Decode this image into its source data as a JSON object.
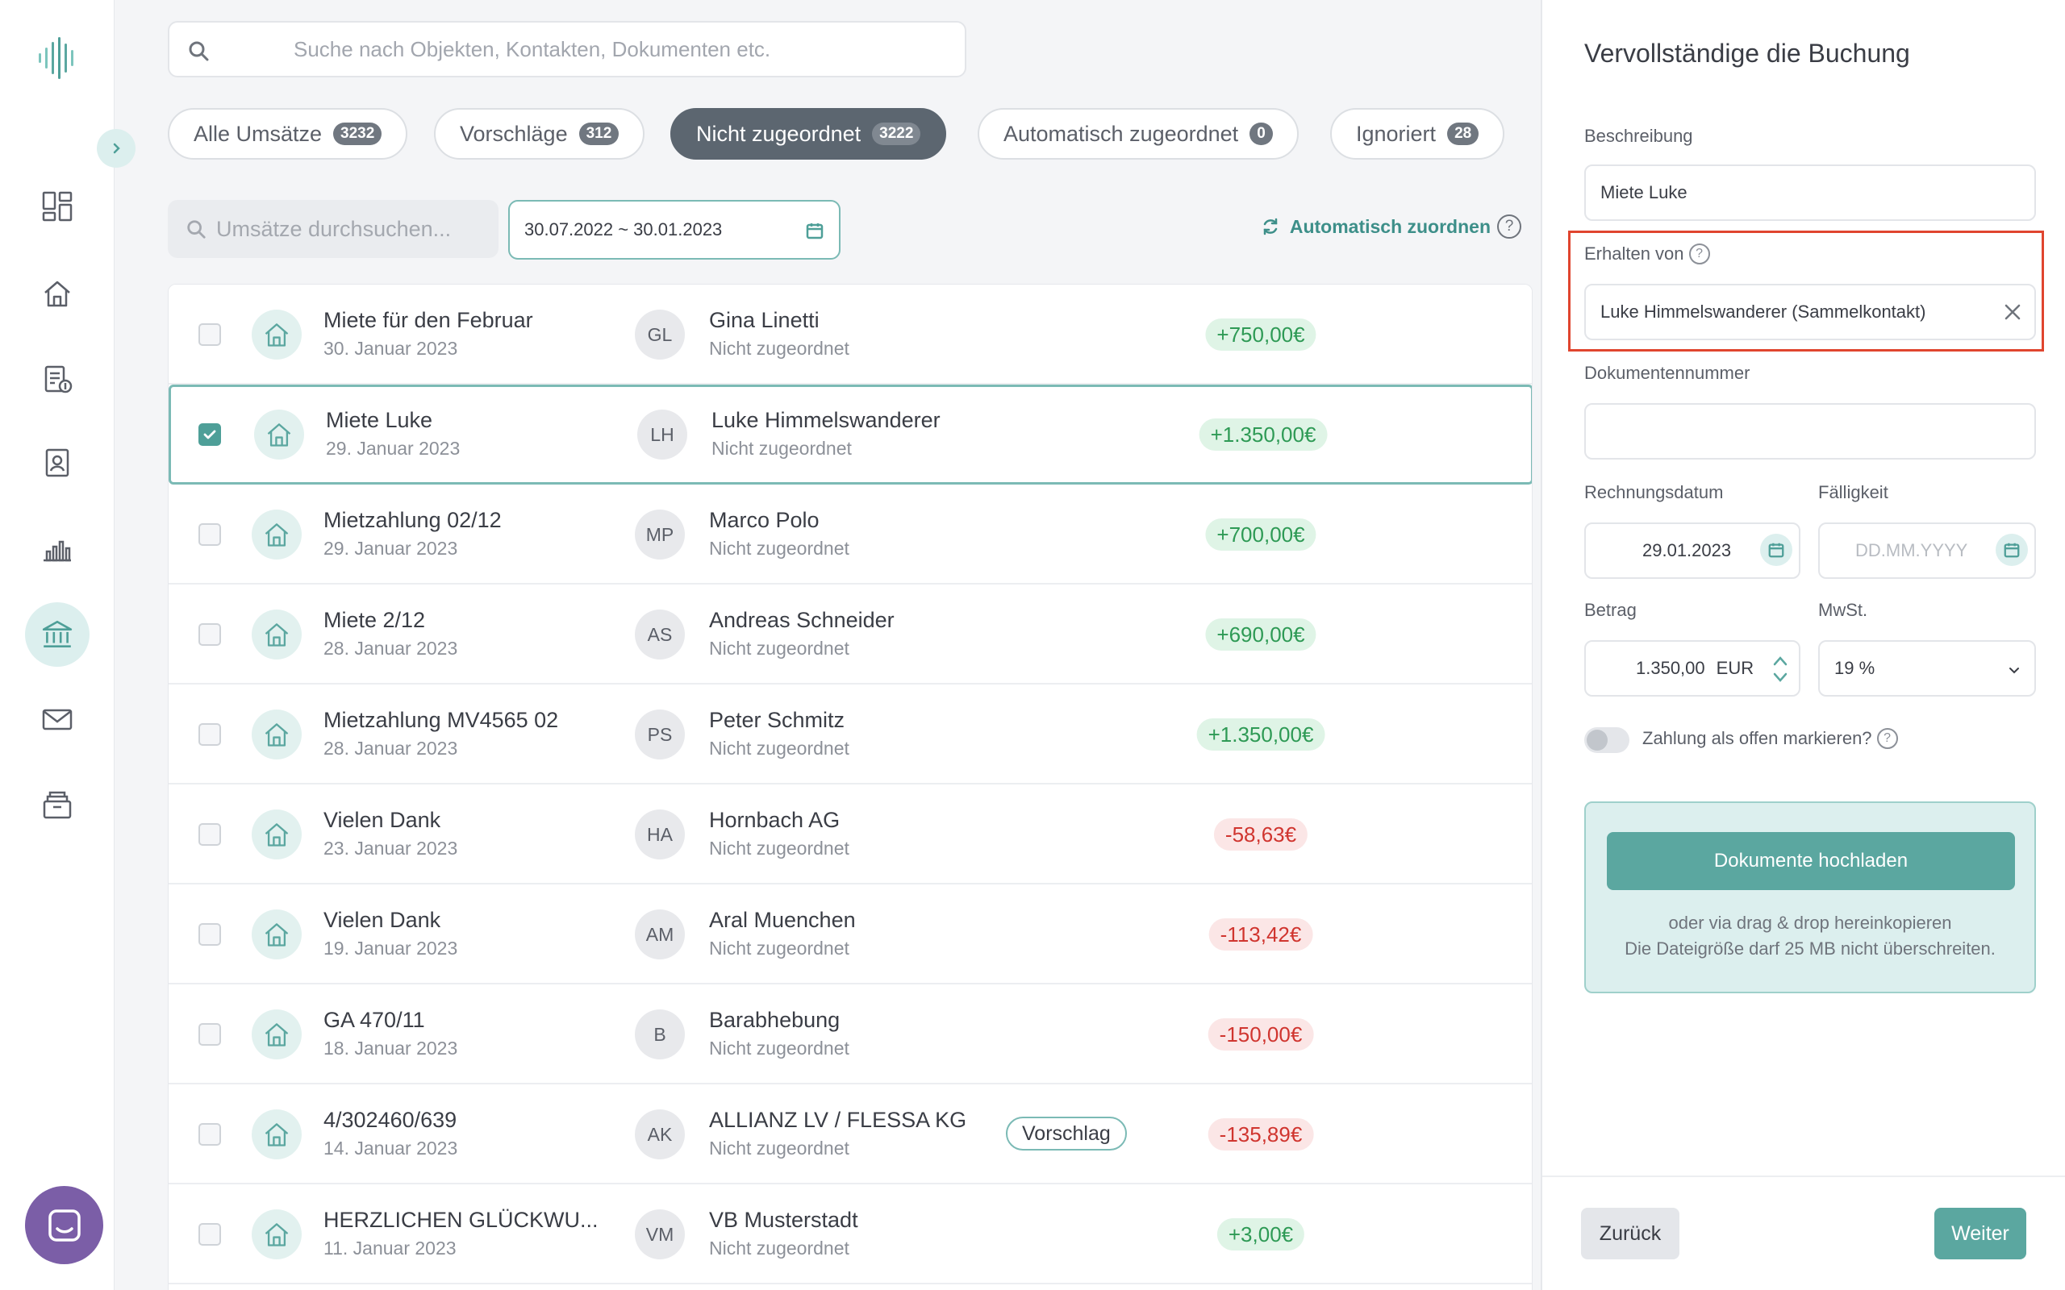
{
  "colors": {
    "accent": "#5ba7a0",
    "positive": "#2e9a55",
    "negative": "#d0352f",
    "highlight": "#e0452f",
    "chat": "#7b5ea7"
  },
  "sidebar": {
    "logo_icon": "waveform-logo",
    "collapse_icon": "chevron-right-icon",
    "items": [
      {
        "icon": "dashboard-icon"
      },
      {
        "icon": "home-icon"
      },
      {
        "icon": "invoice-icon"
      },
      {
        "icon": "contacts-icon"
      },
      {
        "icon": "chart-icon"
      },
      {
        "icon": "bank-icon",
        "active": true
      },
      {
        "icon": "mail-icon"
      },
      {
        "icon": "archive-icon"
      }
    ],
    "chat_icon": "chat-icon"
  },
  "search": {
    "placeholder": "Suche nach Objekten, Kontakten, Dokumenten etc.",
    "value": ""
  },
  "tabs": [
    {
      "label": "Alle Umsätze",
      "count": "3232"
    },
    {
      "label": "Vorschläge",
      "count": "312"
    },
    {
      "label": "Nicht zugeordnet",
      "count": "3222",
      "active": true
    },
    {
      "label": "Automatisch zugeordnet",
      "count": "0"
    },
    {
      "label": "Ignoriert",
      "count": "28"
    }
  ],
  "filters": {
    "search_placeholder": "Umsätze durchsuchen...",
    "date_range": "30.07.2022 ~ 30.01.2023",
    "auto_assign_label": "Automatisch zuordnen"
  },
  "transactions": [
    {
      "title": "Miete für den Februar",
      "date": "30. Januar 2023",
      "initials": "GL",
      "name": "Gina Linetti",
      "status": "Nicht zugeordnet",
      "amount": "+750,00€",
      "sign": "pos",
      "checked": false
    },
    {
      "title": "Miete Luke",
      "date": "29. Januar 2023",
      "initials": "LH",
      "name": "Luke Himmelswanderer",
      "status": "Nicht zugeordnet",
      "amount": "+1.350,00€",
      "sign": "pos",
      "checked": true
    },
    {
      "title": "Mietzahlung 02/12",
      "date": "29. Januar 2023",
      "initials": "MP",
      "name": "Marco Polo",
      "status": "Nicht zugeordnet",
      "amount": "+700,00€",
      "sign": "pos",
      "checked": false
    },
    {
      "title": "Miete 2/12",
      "date": "28. Januar 2023",
      "initials": "AS",
      "name": "Andreas Schneider",
      "status": "Nicht zugeordnet",
      "amount": "+690,00€",
      "sign": "pos",
      "checked": false
    },
    {
      "title": "Mietzahlung MV4565 02",
      "date": "28. Januar 2023",
      "initials": "PS",
      "name": "Peter Schmitz",
      "status": "Nicht zugeordnet",
      "amount": "+1.350,00€",
      "sign": "pos",
      "checked": false
    },
    {
      "title": "Vielen Dank",
      "date": "23. Januar 2023",
      "initials": "HA",
      "name": "Hornbach AG",
      "status": "Nicht zugeordnet",
      "amount": "-58,63€",
      "sign": "neg",
      "checked": false
    },
    {
      "title": "Vielen Dank",
      "date": "19. Januar 2023",
      "initials": "AM",
      "name": "Aral Muenchen",
      "status": "Nicht zugeordnet",
      "amount": "-113,42€",
      "sign": "neg",
      "checked": false
    },
    {
      "title": "GA 470/11",
      "date": "18. Januar 2023",
      "initials": "B",
      "name": "Barabhebung",
      "status": "Nicht zugeordnet",
      "amount": "-150,00€",
      "sign": "neg",
      "checked": false
    },
    {
      "title": "4/302460/639",
      "date": "14. Januar 2023",
      "initials": "AK",
      "name": "ALLIANZ LV / FLESSA KG",
      "status": "Nicht zugeordnet",
      "amount": "-135,89€",
      "sign": "neg",
      "checked": false,
      "badge": "Vorschlag"
    },
    {
      "title": "HERZLICHEN GLÜCKWU...",
      "date": "11. Januar 2023",
      "initials": "VM",
      "name": "VB Musterstadt",
      "status": "Nicht zugeordnet",
      "amount": "+3,00€",
      "sign": "pos",
      "checked": false
    }
  ],
  "panel": {
    "title": "Vervollständige die Buchung",
    "description_label": "Beschreibung",
    "description_value": "Miete Luke",
    "received_from_label": "Erhalten von",
    "received_from_value": "Luke Himmelswanderer (Sammelkontakt)",
    "document_number_label": "Dokumentennummer",
    "document_number_value": "",
    "invoice_date_label": "Rechnungsdatum",
    "invoice_date_value": "29.01.2023",
    "due_label": "Fälligkeit",
    "due_placeholder": "DD.MM.YYYY",
    "amount_label": "Betrag",
    "amount_value": "1.350,00",
    "currency": "EUR",
    "vat_label": "MwSt.",
    "vat_value": "19 %",
    "open_payment_label": "Zahlung als offen markieren?",
    "upload_button": "Dokumente hochladen",
    "upload_hint_1": "oder via drag & drop hereinkopieren",
    "upload_hint_2": "Die Dateigröße darf 25 MB nicht überschreiten.",
    "back_button": "Zurück",
    "next_button": "Weiter"
  }
}
